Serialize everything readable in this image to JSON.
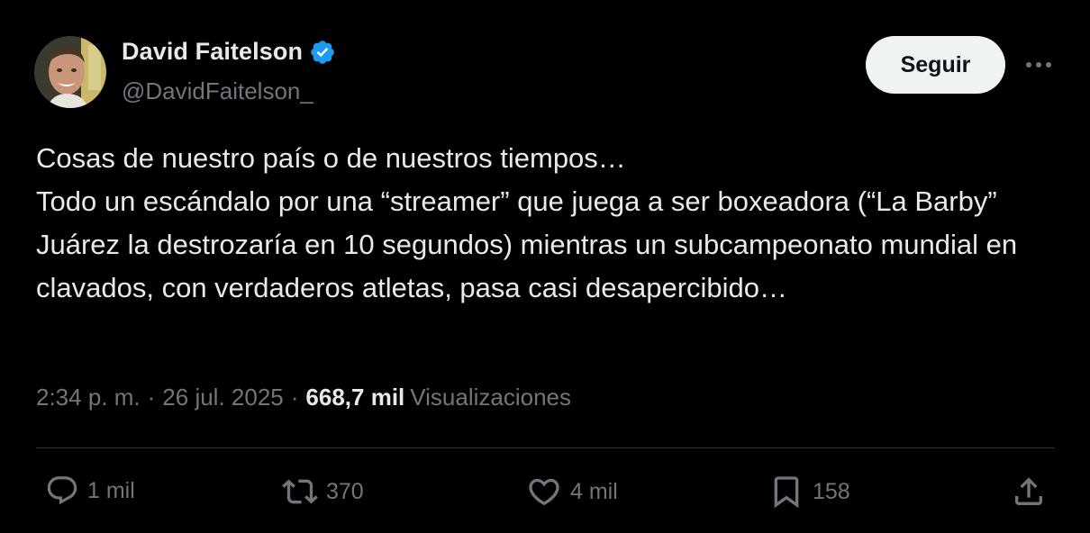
{
  "colors": {
    "background": "#000000",
    "text_primary": "#e7e9ea",
    "text_secondary": "#71767b",
    "verified_badge": "#1d9bf0",
    "follow_button_bg": "#eff3f4",
    "divider": "#2f3336"
  },
  "author": {
    "display_name": "David Faitelson",
    "handle": "@DavidFaitelson_",
    "verified": true,
    "verified_icon": "verified-badge-icon",
    "avatar": "profile-photo"
  },
  "header": {
    "follow_label": "Seguir",
    "more_icon": "more-options-icon"
  },
  "tweet": {
    "text": "Cosas de nuestro país o de nuestros tiempos…\nTodo un escándalo por una “streamer” que juega a ser boxeadora (“La Barby” Juárez la destrozaría en 10 segundos) mientras un subcampeonato mundial en clavados, con verdaderos atletas, pasa casi desapercibido…",
    "time": "2:34 p. m.",
    "separator": "·",
    "date": "26 jul. 2025",
    "views_count": "668,7 mil",
    "views_label": "Visualizaciones"
  },
  "actions": [
    {
      "name": "reply",
      "icon": "reply-icon",
      "count": "1 mil"
    },
    {
      "name": "repost",
      "icon": "repost-icon",
      "count": "370"
    },
    {
      "name": "like",
      "icon": "heart-icon",
      "count": "4 mil"
    },
    {
      "name": "bookmark",
      "icon": "bookmark-icon",
      "count": "158"
    },
    {
      "name": "share",
      "icon": "share-icon",
      "count": ""
    }
  ]
}
